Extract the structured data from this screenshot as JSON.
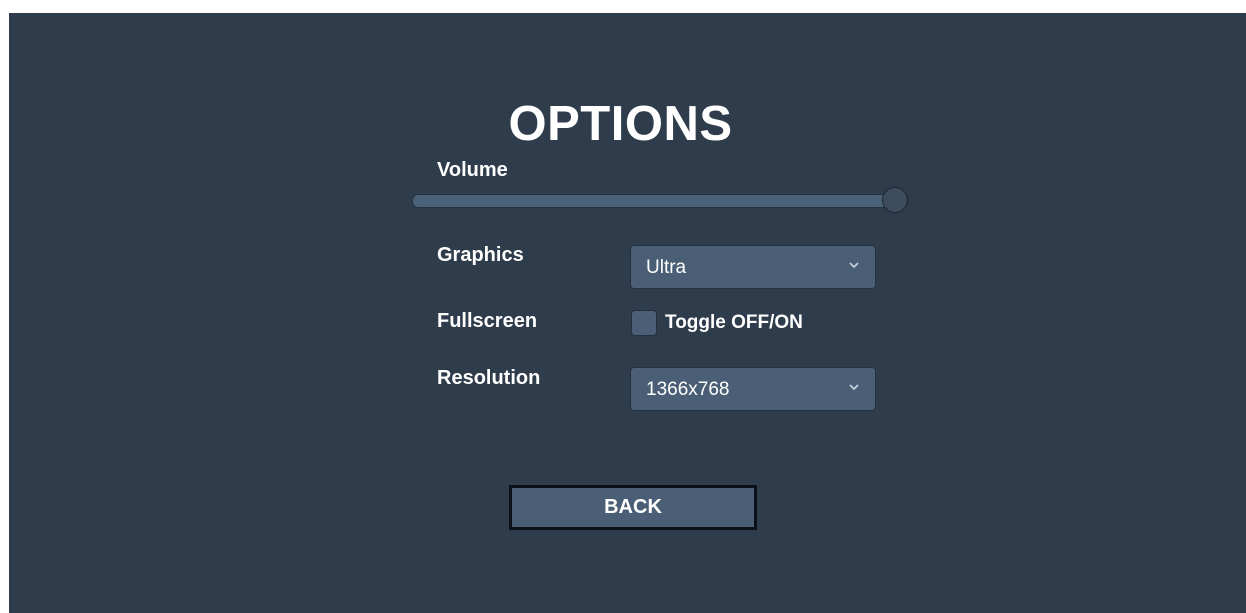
{
  "title": "OPTIONS",
  "volume": {
    "label": "Volume",
    "value": 1.0
  },
  "graphics": {
    "label": "Graphics",
    "selected": "Ultra",
    "icon": "chevron-down-icon"
  },
  "fullscreen": {
    "label": "Fullscreen",
    "toggle_label": "Toggle OFF/ON",
    "checked": false
  },
  "resolution": {
    "label": "Resolution",
    "selected": "1366x768",
    "icon": "chevron-down-icon"
  },
  "back_button": {
    "label": "BACK"
  },
  "colors": {
    "background": "#2f3c4b",
    "control": "#4a5f75",
    "text": "#ffffff"
  }
}
